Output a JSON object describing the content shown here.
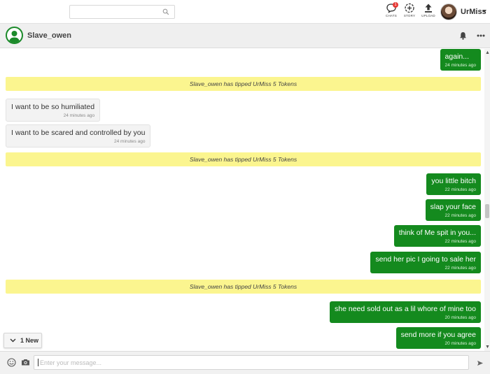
{
  "search": {
    "placeholder": ""
  },
  "nav": {
    "chats_label": "CHATS",
    "chats_badge": "1",
    "story_label": "STORY",
    "upload_label": "UPLOAD"
  },
  "profile": {
    "name": "UrMiss"
  },
  "conversation": {
    "contact_name": "Slave_owen"
  },
  "messages": [
    {
      "dir": "out",
      "text": "again...",
      "time": "24 minutes ago"
    },
    {
      "dir": "tip",
      "text": "Slave_owen has tipped UrMiss 5 Tokens"
    },
    {
      "dir": "in",
      "text": "I want to be so humiliated",
      "time": "24 minutes ago"
    },
    {
      "dir": "in",
      "text": "I want to be scared and controlled by you",
      "time": "24 minutes ago"
    },
    {
      "dir": "tip",
      "text": "Slave_owen has tipped UrMiss 5 Tokens"
    },
    {
      "dir": "out",
      "text": "you little bitch",
      "time": "22 minutes ago"
    },
    {
      "dir": "out",
      "text": "slap your face",
      "time": "22 minutes ago"
    },
    {
      "dir": "out",
      "text": "think of Me spit in you...",
      "time": "22 minutes ago"
    },
    {
      "dir": "out",
      "text": "send her pic I going to sale her",
      "time": "22 minutes ago"
    },
    {
      "dir": "tip",
      "text": "Slave_owen has tipped UrMiss 5 Tokens"
    },
    {
      "dir": "out",
      "text": "she need sold out as a lil whore of mine too",
      "time": "20 minutes ago"
    },
    {
      "dir": "out",
      "text": "send more if you agree",
      "time": "20 minutes ago"
    }
  ],
  "new_messages": {
    "label": "1 New"
  },
  "composer": {
    "placeholder": "Enter your message..."
  },
  "colors": {
    "outgoing": "#148a1e",
    "tip": "#fbf58f",
    "avatar_ring": "#1b8a2a"
  }
}
